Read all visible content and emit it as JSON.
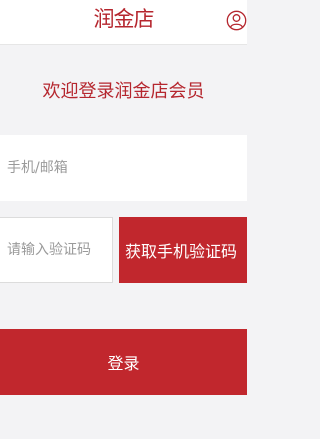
{
  "header": {
    "logo_text": "润金店",
    "user_icon": "user-icon",
    "brand_color": "#b5262e"
  },
  "welcome": {
    "title": "欢迎登录润金店会员"
  },
  "form": {
    "phone_placeholder": "手机/邮箱",
    "phone_value": "",
    "code_placeholder": "请输入验证码",
    "code_value": "",
    "get_code_label": "获取手机验证码",
    "login_label": "登录",
    "button_color": "#c1272d"
  }
}
